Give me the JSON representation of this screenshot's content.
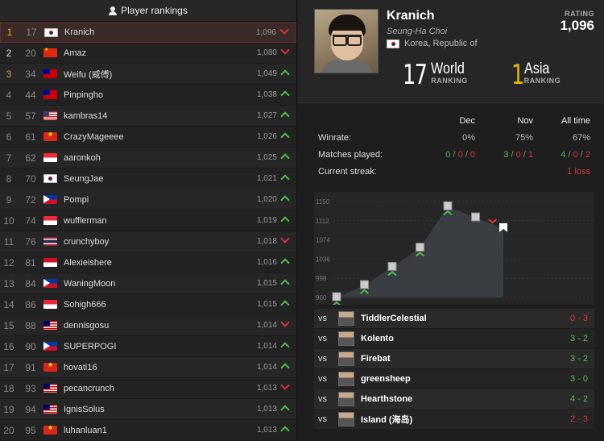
{
  "left_panel": {
    "title": "Player rankings",
    "rows": [
      {
        "pos": "1",
        "world": "17",
        "flag": "kr",
        "name": "Kranich",
        "rating": "1,096",
        "trend": "down",
        "selected": true
      },
      {
        "pos": "2",
        "world": "20",
        "flag": "cn",
        "name": "Amaz",
        "rating": "1,080",
        "trend": "down"
      },
      {
        "pos": "3",
        "world": "34",
        "flag": "tw",
        "name": "Weifu (威傅)",
        "rating": "1,049",
        "trend": "up"
      },
      {
        "pos": "4",
        "world": "44",
        "flag": "tw",
        "name": "Pinpingho",
        "rating": "1,038",
        "trend": "up"
      },
      {
        "pos": "5",
        "world": "57",
        "flag": "us",
        "name": "kambras14",
        "rating": "1,027",
        "trend": "up"
      },
      {
        "pos": "6",
        "world": "61",
        "flag": "vn",
        "name": "CrazyMageeee",
        "rating": "1,026",
        "trend": "up"
      },
      {
        "pos": "7",
        "world": "62",
        "flag": "sg",
        "name": "aaronkoh",
        "rating": "1,025",
        "trend": "up"
      },
      {
        "pos": "8",
        "world": "70",
        "flag": "kr",
        "name": "SeungJae",
        "rating": "1,021",
        "trend": "up"
      },
      {
        "pos": "9",
        "world": "72",
        "flag": "ph",
        "name": "Pompi",
        "rating": "1,020",
        "trend": "up"
      },
      {
        "pos": "10",
        "world": "74",
        "flag": "sg",
        "name": "wufflerman",
        "rating": "1,019",
        "trend": "up"
      },
      {
        "pos": "11",
        "world": "76",
        "flag": "th",
        "name": "crunchyboy",
        "rating": "1,018",
        "trend": "down"
      },
      {
        "pos": "12",
        "world": "81",
        "flag": "id",
        "name": "Alexieishere",
        "rating": "1,016",
        "trend": "up"
      },
      {
        "pos": "13",
        "world": "84",
        "flag": "ph",
        "name": "WaningMoon",
        "rating": "1,015",
        "trend": "up"
      },
      {
        "pos": "14",
        "world": "86",
        "flag": "sg",
        "name": "Sohigh666",
        "rating": "1,015",
        "trend": "up"
      },
      {
        "pos": "15",
        "world": "88",
        "flag": "my",
        "name": "dennisgosu",
        "rating": "1,014",
        "trend": "down"
      },
      {
        "pos": "16",
        "world": "90",
        "flag": "ph",
        "name": "SUPERPOGI",
        "rating": "1,014",
        "trend": "up"
      },
      {
        "pos": "17",
        "world": "91",
        "flag": "vn",
        "name": "hovati16",
        "rating": "1,014",
        "trend": "up"
      },
      {
        "pos": "18",
        "world": "93",
        "flag": "my",
        "name": "pecancrunch",
        "rating": "1,013",
        "trend": "down"
      },
      {
        "pos": "19",
        "world": "94",
        "flag": "my",
        "name": "IgnisSolus",
        "rating": "1,013",
        "trend": "up"
      },
      {
        "pos": "20",
        "world": "95",
        "flag": "vn",
        "name": "luhanluan1",
        "rating": "1,013",
        "trend": "up"
      }
    ]
  },
  "profile": {
    "name": "Kranich",
    "real_name": "Seung-Ha Choi",
    "country": "Korea, Republic of",
    "rating_label": "RATING",
    "rating": "1,096",
    "world_rank": "17",
    "world_label": "World",
    "world_sub": "RANKING",
    "asia_rank": "1",
    "asia_label": "Asia",
    "asia_sub": "RANKING"
  },
  "stats": {
    "headers": [
      "Dec",
      "Nov",
      "All time"
    ],
    "winrate": {
      "label": "Winrate:",
      "values": [
        "0%",
        "75%",
        "67%"
      ]
    },
    "matches": {
      "label": "Matches played:",
      "values": [
        {
          "w": "0",
          "d": "0",
          "l": "0"
        },
        {
          "w": "3",
          "d": "0",
          "l": "1"
        },
        {
          "w": "4",
          "d": "0",
          "l": "2"
        }
      ]
    },
    "streak": {
      "label": "Current streak:",
      "value": "1 loss"
    }
  },
  "chart_data": {
    "type": "area",
    "y_ticks": [
      "1150",
      "1112",
      "1074",
      "1036",
      "998",
      "960"
    ],
    "ylim": [
      960,
      1150
    ],
    "points": [
      {
        "y": 960,
        "result": "win"
      },
      {
        "y": 984,
        "result": "win"
      },
      {
        "y": 1020,
        "result": "win"
      },
      {
        "y": 1058,
        "result": "win"
      },
      {
        "y": 1140,
        "result": "win"
      },
      {
        "y": 1118,
        "result": "loss"
      },
      {
        "y": 1096,
        "result": "current"
      }
    ]
  },
  "matches": [
    {
      "vs": "vs",
      "opponent": "TiddlerCelestial",
      "score": "0 - 3",
      "result": "loss"
    },
    {
      "vs": "vs",
      "opponent": "Kolento",
      "score": "3 - 2",
      "result": "win"
    },
    {
      "vs": "vs",
      "opponent": "Firebat",
      "score": "3 - 2",
      "result": "win"
    },
    {
      "vs": "vs",
      "opponent": "greensheep",
      "score": "3 - 0",
      "result": "win"
    },
    {
      "vs": "vs",
      "opponent": "Hearthstone",
      "score": "4 - 2",
      "result": "win"
    },
    {
      "vs": "vs",
      "opponent": "Island (海岛)",
      "score": "2 - 3",
      "result": "loss"
    }
  ],
  "colors": {
    "win": "#4bbf4b",
    "loss": "#dd3333",
    "gold": "#e6b800",
    "accent": "#c0392b"
  }
}
